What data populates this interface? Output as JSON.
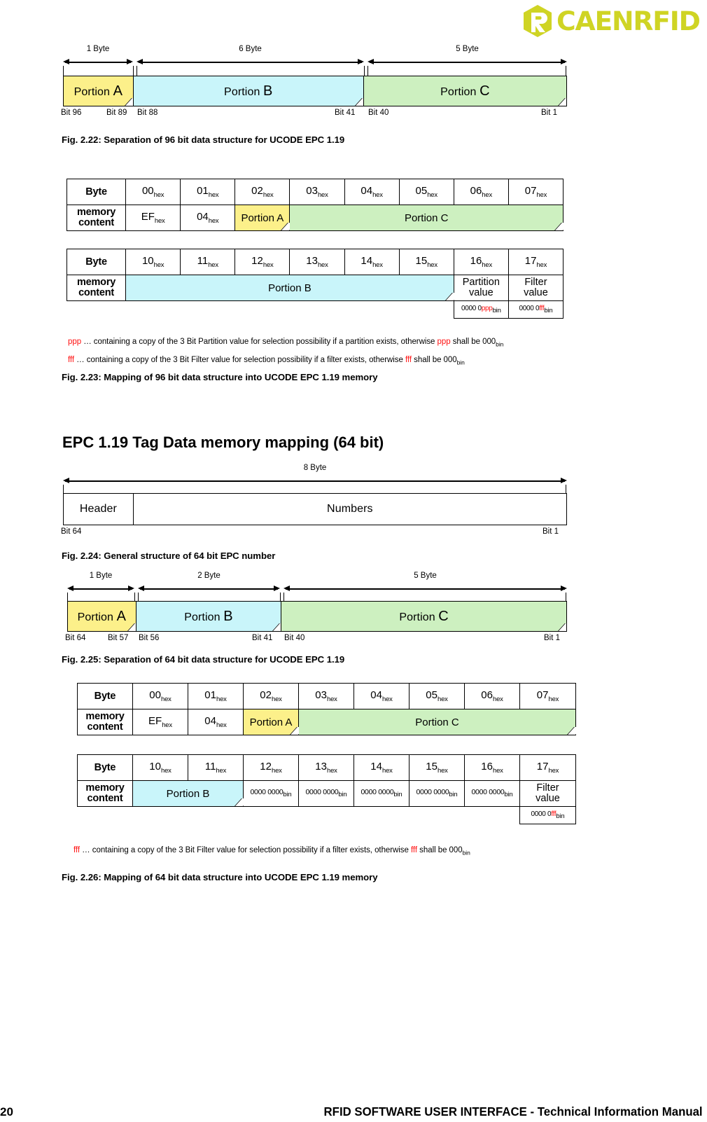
{
  "brand": {
    "logo_text": "CAENRFID",
    "logo_color": "#cfd424",
    "logo_icon": "hexagon-r-icon"
  },
  "colors": {
    "portion_a": "#fcf08a",
    "portion_b": "#c9f5fa",
    "portion_c": "#cdf0c0",
    "accent_red": "#ff1111",
    "line": "#000000"
  },
  "fig_2_22": {
    "caption": "Fig. 2.22: Separation of 96 bit data structure for UCODE EPC 1.19",
    "segments": [
      {
        "size_label": "1 Byte",
        "portion": "Portion",
        "portion_letter": "A",
        "fill": "#fcf08a"
      },
      {
        "size_label": "6 Byte",
        "portion": "Portion",
        "portion_letter": "B",
        "fill": "#c9f5fa"
      },
      {
        "size_label": "5 Byte",
        "portion": "Portion",
        "portion_letter": "C",
        "fill": "#cdf0c0"
      }
    ],
    "bit_labels": [
      "Bit 96",
      "Bit 89",
      "Bit 88",
      "Bit 41",
      "Bit 40",
      "Bit 1"
    ]
  },
  "fig_2_23": {
    "caption": "Fig. 2.23: Mapping of 96 bit data structure into UCODE EPC 1.19 memory",
    "table_top": {
      "row_header_1": "Byte",
      "row_header_2": "memory content",
      "bytes": [
        "00",
        "01",
        "02",
        "03",
        "04",
        "05",
        "06",
        "07"
      ],
      "byte_sub": "hex",
      "cells": [
        {
          "text": "EF",
          "sub": "hex",
          "fill": "none",
          "span": 1
        },
        {
          "text": "04",
          "sub": "hex",
          "fill": "none",
          "span": 1
        },
        {
          "text": "Portion A",
          "sub": "",
          "fill": "#fcf08a",
          "span": 1
        },
        {
          "text": "Portion C",
          "sub": "",
          "fill": "#cdf0c0",
          "span": 5
        }
      ]
    },
    "table_bottom": {
      "row_header_1": "Byte",
      "row_header_2": "memory content",
      "bytes": [
        "10",
        "11",
        "12",
        "13",
        "14",
        "15",
        "16",
        "17"
      ],
      "byte_sub": "hex",
      "cells": [
        {
          "text": "Portion B",
          "sub": "",
          "fill": "#c9f5fa",
          "span": 6
        },
        {
          "text": "Partition value",
          "sub": "",
          "fill": "none",
          "span": 1
        },
        {
          "text": "Filter value",
          "sub": "",
          "fill": "none",
          "span": 1
        }
      ],
      "bin_row": [
        {
          "prefix": "0000 0",
          "var": "ppp",
          "sub": "bin"
        },
        {
          "prefix": "0000 0",
          "var": "fff",
          "sub": "bin"
        }
      ]
    },
    "notes": [
      {
        "var": "ppp",
        "text_before": " … containing a copy of the 3 Bit Partition value for selection possibility if a partition exists, otherwise ",
        "var2": "ppp",
        "text_after": " shall be 000",
        "sub": "bin"
      },
      {
        "var": "fff",
        "text_before": " … containing a copy of the 3 Bit Filter value for selection possibility if a filter exists, otherwise  ",
        "var2": "fff",
        "text_after": " shall be 000",
        "sub": "bin"
      }
    ]
  },
  "heading_64bit": "EPC 1.19 Tag Data memory mapping (64 bit)",
  "fig_2_24": {
    "caption": "Fig. 2.24: General structure of 64 bit EPC number",
    "size_label": "8 Byte",
    "fields": [
      "Header",
      "Numbers"
    ],
    "bit_labels": [
      "Bit 64",
      "Bit 1"
    ]
  },
  "fig_2_25": {
    "caption": "Fig. 2.25: Separation of 64 bit data structure for UCODE EPC 1.19",
    "segments": [
      {
        "size_label": "1 Byte",
        "portion": "Portion",
        "portion_letter": "A",
        "fill": "#fcf08a"
      },
      {
        "size_label": "2 Byte",
        "portion": "Portion",
        "portion_letter": "B",
        "fill": "#c9f5fa"
      },
      {
        "size_label": "5 Byte",
        "portion": "Portion",
        "portion_letter": "C",
        "fill": "#cdf0c0"
      }
    ],
    "bit_labels": [
      "Bit 64",
      "Bit 57",
      "Bit 56",
      "Bit 41",
      "Bit 40",
      "Bit 1"
    ]
  },
  "fig_2_26": {
    "caption": "Fig. 2.26: Mapping of 64 bit data structure into UCODE EPC 1.19 memory",
    "table_top": {
      "row_header_1": "Byte",
      "row_header_2": "memory content",
      "bytes": [
        "00",
        "01",
        "02",
        "03",
        "04",
        "05",
        "06",
        "07"
      ],
      "byte_sub": "hex",
      "cells": [
        {
          "text": "EF",
          "sub": "hex",
          "fill": "none",
          "span": 1
        },
        {
          "text": "04",
          "sub": "hex",
          "fill": "none",
          "span": 1
        },
        {
          "text": "Portion A",
          "sub": "",
          "fill": "#fcf08a",
          "span": 1
        },
        {
          "text": "Portion C",
          "sub": "",
          "fill": "#cdf0c0",
          "span": 5
        }
      ]
    },
    "table_bottom": {
      "row_header_1": "Byte",
      "row_header_2": "memory content",
      "bytes": [
        "10",
        "11",
        "12",
        "13",
        "14",
        "15",
        "16",
        "17"
      ],
      "byte_sub": "hex",
      "cells": [
        {
          "text": "Portion B",
          "sub": "",
          "fill": "#c9f5fa",
          "span": 2
        },
        {
          "text": "0000 0000",
          "sub": "bin",
          "fill": "none",
          "span": 1
        },
        {
          "text": "0000 0000",
          "sub": "bin",
          "fill": "none",
          "span": 1
        },
        {
          "text": "0000 0000",
          "sub": "bin",
          "fill": "none",
          "span": 1
        },
        {
          "text": "0000 0000",
          "sub": "bin",
          "fill": "none",
          "span": 1
        },
        {
          "text": "0000 0000",
          "sub": "bin",
          "fill": "none",
          "span": 1
        },
        {
          "text": "Filter value",
          "sub": "",
          "fill": "none",
          "span": 1
        }
      ],
      "bin_row": [
        {
          "prefix": "0000 0",
          "var": "fff",
          "sub": "bin"
        }
      ]
    },
    "notes": [
      {
        "var": "fff",
        "text_before": " … containing a copy of the 3 Bit Filter value for selection possibility if a filter exists, otherwise  ",
        "var2": "fff",
        "text_after": " shall be 000",
        "sub": "bin"
      }
    ]
  },
  "footer": {
    "page_number": "20",
    "title": "RFID SOFTWARE USER INTERFACE - Technical Information Manual"
  }
}
